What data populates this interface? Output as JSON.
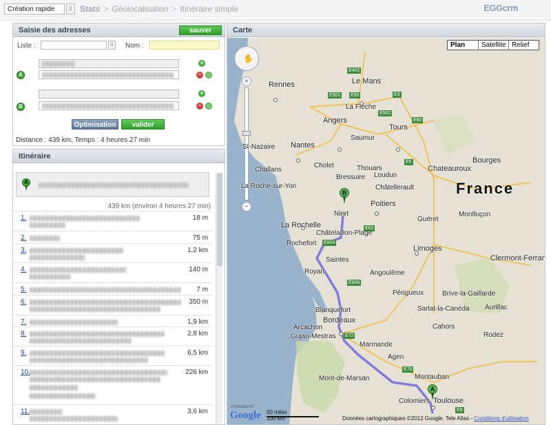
{
  "topbar": {
    "quick_select": "Création rapide",
    "breadcrumb": [
      "Stats",
      "Géolocalisation",
      "Itinéraire simple"
    ],
    "logo": "EGGcrm"
  },
  "saisie": {
    "title": "Saisie des adresses",
    "save_label": "sauver",
    "liste_label": "Liste :",
    "nom_label": "Nom :",
    "marker_a": "A",
    "marker_b": "B",
    "optimisation_label": "Optimisation",
    "valider_label": "valider",
    "distance": "Distance : 439 km, Temps : 4 heures 27 min"
  },
  "itineraire": {
    "title": "Itinéraire",
    "start_marker": "A",
    "total": "439 km (environ 4 heures 27 min)",
    "steps": [
      {
        "num": "1.",
        "dist": "18 m"
      },
      {
        "num": "2.",
        "dist": "75 m"
      },
      {
        "num": "3.",
        "dist": "1,2 km"
      },
      {
        "num": "4.",
        "dist": "140 m"
      },
      {
        "num": "5.",
        "dist": "7 m"
      },
      {
        "num": "6.",
        "dist": "350 m"
      },
      {
        "num": "7.",
        "dist": "1,9 km"
      },
      {
        "num": "8.",
        "dist": "2,8 km"
      },
      {
        "num": "9.",
        "dist": "6,5 km"
      },
      {
        "num": "10.",
        "dist": "226 km"
      },
      {
        "num": "11.",
        "dist": "3,6 km"
      }
    ]
  },
  "carte": {
    "title": "Carte",
    "map_types": [
      "Plan",
      "Satellite",
      "Relief"
    ],
    "country": "France",
    "cities": {
      "rennes": "Rennes",
      "le_mans": "Le Mans",
      "angers": "Angers",
      "tours": "Tours",
      "la_fleche": "La Flèche",
      "saumur": "Saumur",
      "nantes": "Nantes",
      "st_nazaire": "St-Nazaire",
      "cholet": "Cholet",
      "la_roche": "La Roche-sur-Yon",
      "niort": "Niort",
      "poitiers": "Poitiers",
      "la_rochelle": "La Rochelle",
      "chatelaillon": "Châtelaillon-Plage",
      "rochefort": "Rochefort",
      "saintes": "Saintes",
      "royan": "Royan",
      "limoges": "Limoges",
      "clermont": "Clermont-Ferrand",
      "chateauroux": "Chateauroux",
      "bourges": "Bourges",
      "blanquefort": "Blanquefort",
      "bordeaux": "Bordeaux",
      "arcachon": "Arcachon",
      "gujan": "Gujan-Mestras",
      "marmande": "Marmande",
      "agen": "Agen",
      "montauban": "Montauban",
      "toulouse": "Toulouse",
      "colomiers": "Colomiers",
      "mont_de_marsan": "Mont-de-Marsan",
      "sarlat": "Sarlat-la-Canéda",
      "brive": "Brive-la-Gaillarde",
      "aurillac": "Aurillac",
      "cahors": "Cahors",
      "rodez": "Rodez",
      "montlucon": "Montluçon",
      "gueret": "Guéret",
      "chatellerault": "Châtellerault",
      "angouleme": "Angoulême",
      "perigueux": "Périgueux",
      "bressuire": "Bressuire",
      "thouars": "Thouars",
      "loudun": "Loudun",
      "challans": "Challans",
      "montluc_label": "Montluçon"
    },
    "road_badges": [
      "E402",
      "E50",
      "E501",
      "E3",
      "E502",
      "E60",
      "E5",
      "E62",
      "E604",
      "E606",
      "E72",
      "E70",
      "E9"
    ],
    "marker_a": "A",
    "marker_b": "B",
    "powered": "POWERED BY",
    "google": "Google",
    "scale_miles": "50 miles",
    "scale_km": "100 km",
    "attribution": "Données cartographiques ©2012 Google, Tele Atlas -",
    "conditions": "Conditions d'utilisation"
  }
}
